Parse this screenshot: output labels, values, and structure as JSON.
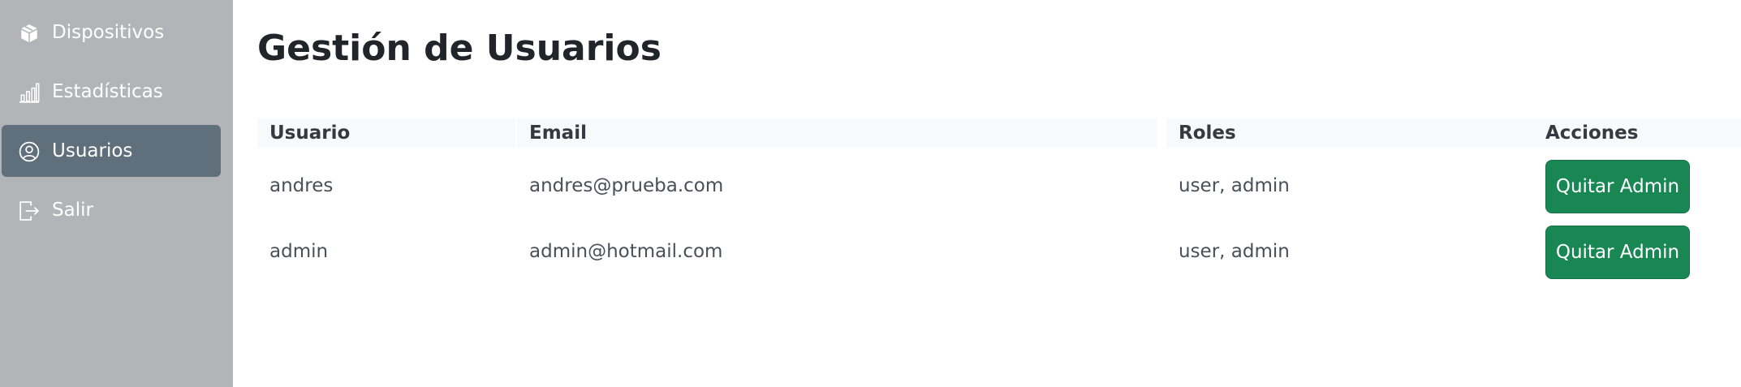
{
  "sidebar": {
    "items": [
      {
        "label": "Dispositivos",
        "icon": "box-icon",
        "active": false
      },
      {
        "label": "Estadísticas",
        "icon": "bar-chart-icon",
        "active": false
      },
      {
        "label": "Usuarios",
        "icon": "user-circle-icon",
        "active": true
      },
      {
        "label": "Salir",
        "icon": "logout-icon",
        "active": false
      }
    ]
  },
  "main": {
    "title": "Gestión de Usuarios",
    "table": {
      "headers": [
        "Usuario",
        "Email",
        "Roles",
        "Acciones"
      ],
      "rows": [
        {
          "usuario": "andres",
          "email": "andres@prueba.com",
          "roles": "user, admin",
          "action": "Quitar Admin"
        },
        {
          "usuario": "admin",
          "email": "admin@hotmail.com",
          "roles": "user, admin",
          "action": "Quitar Admin"
        }
      ]
    }
  },
  "colors": {
    "sidebar_bg": "#b3b4b7",
    "sidebar_active": "#5f6f7b",
    "button_green": "#198754",
    "header_bg": "#f8f9fa"
  }
}
